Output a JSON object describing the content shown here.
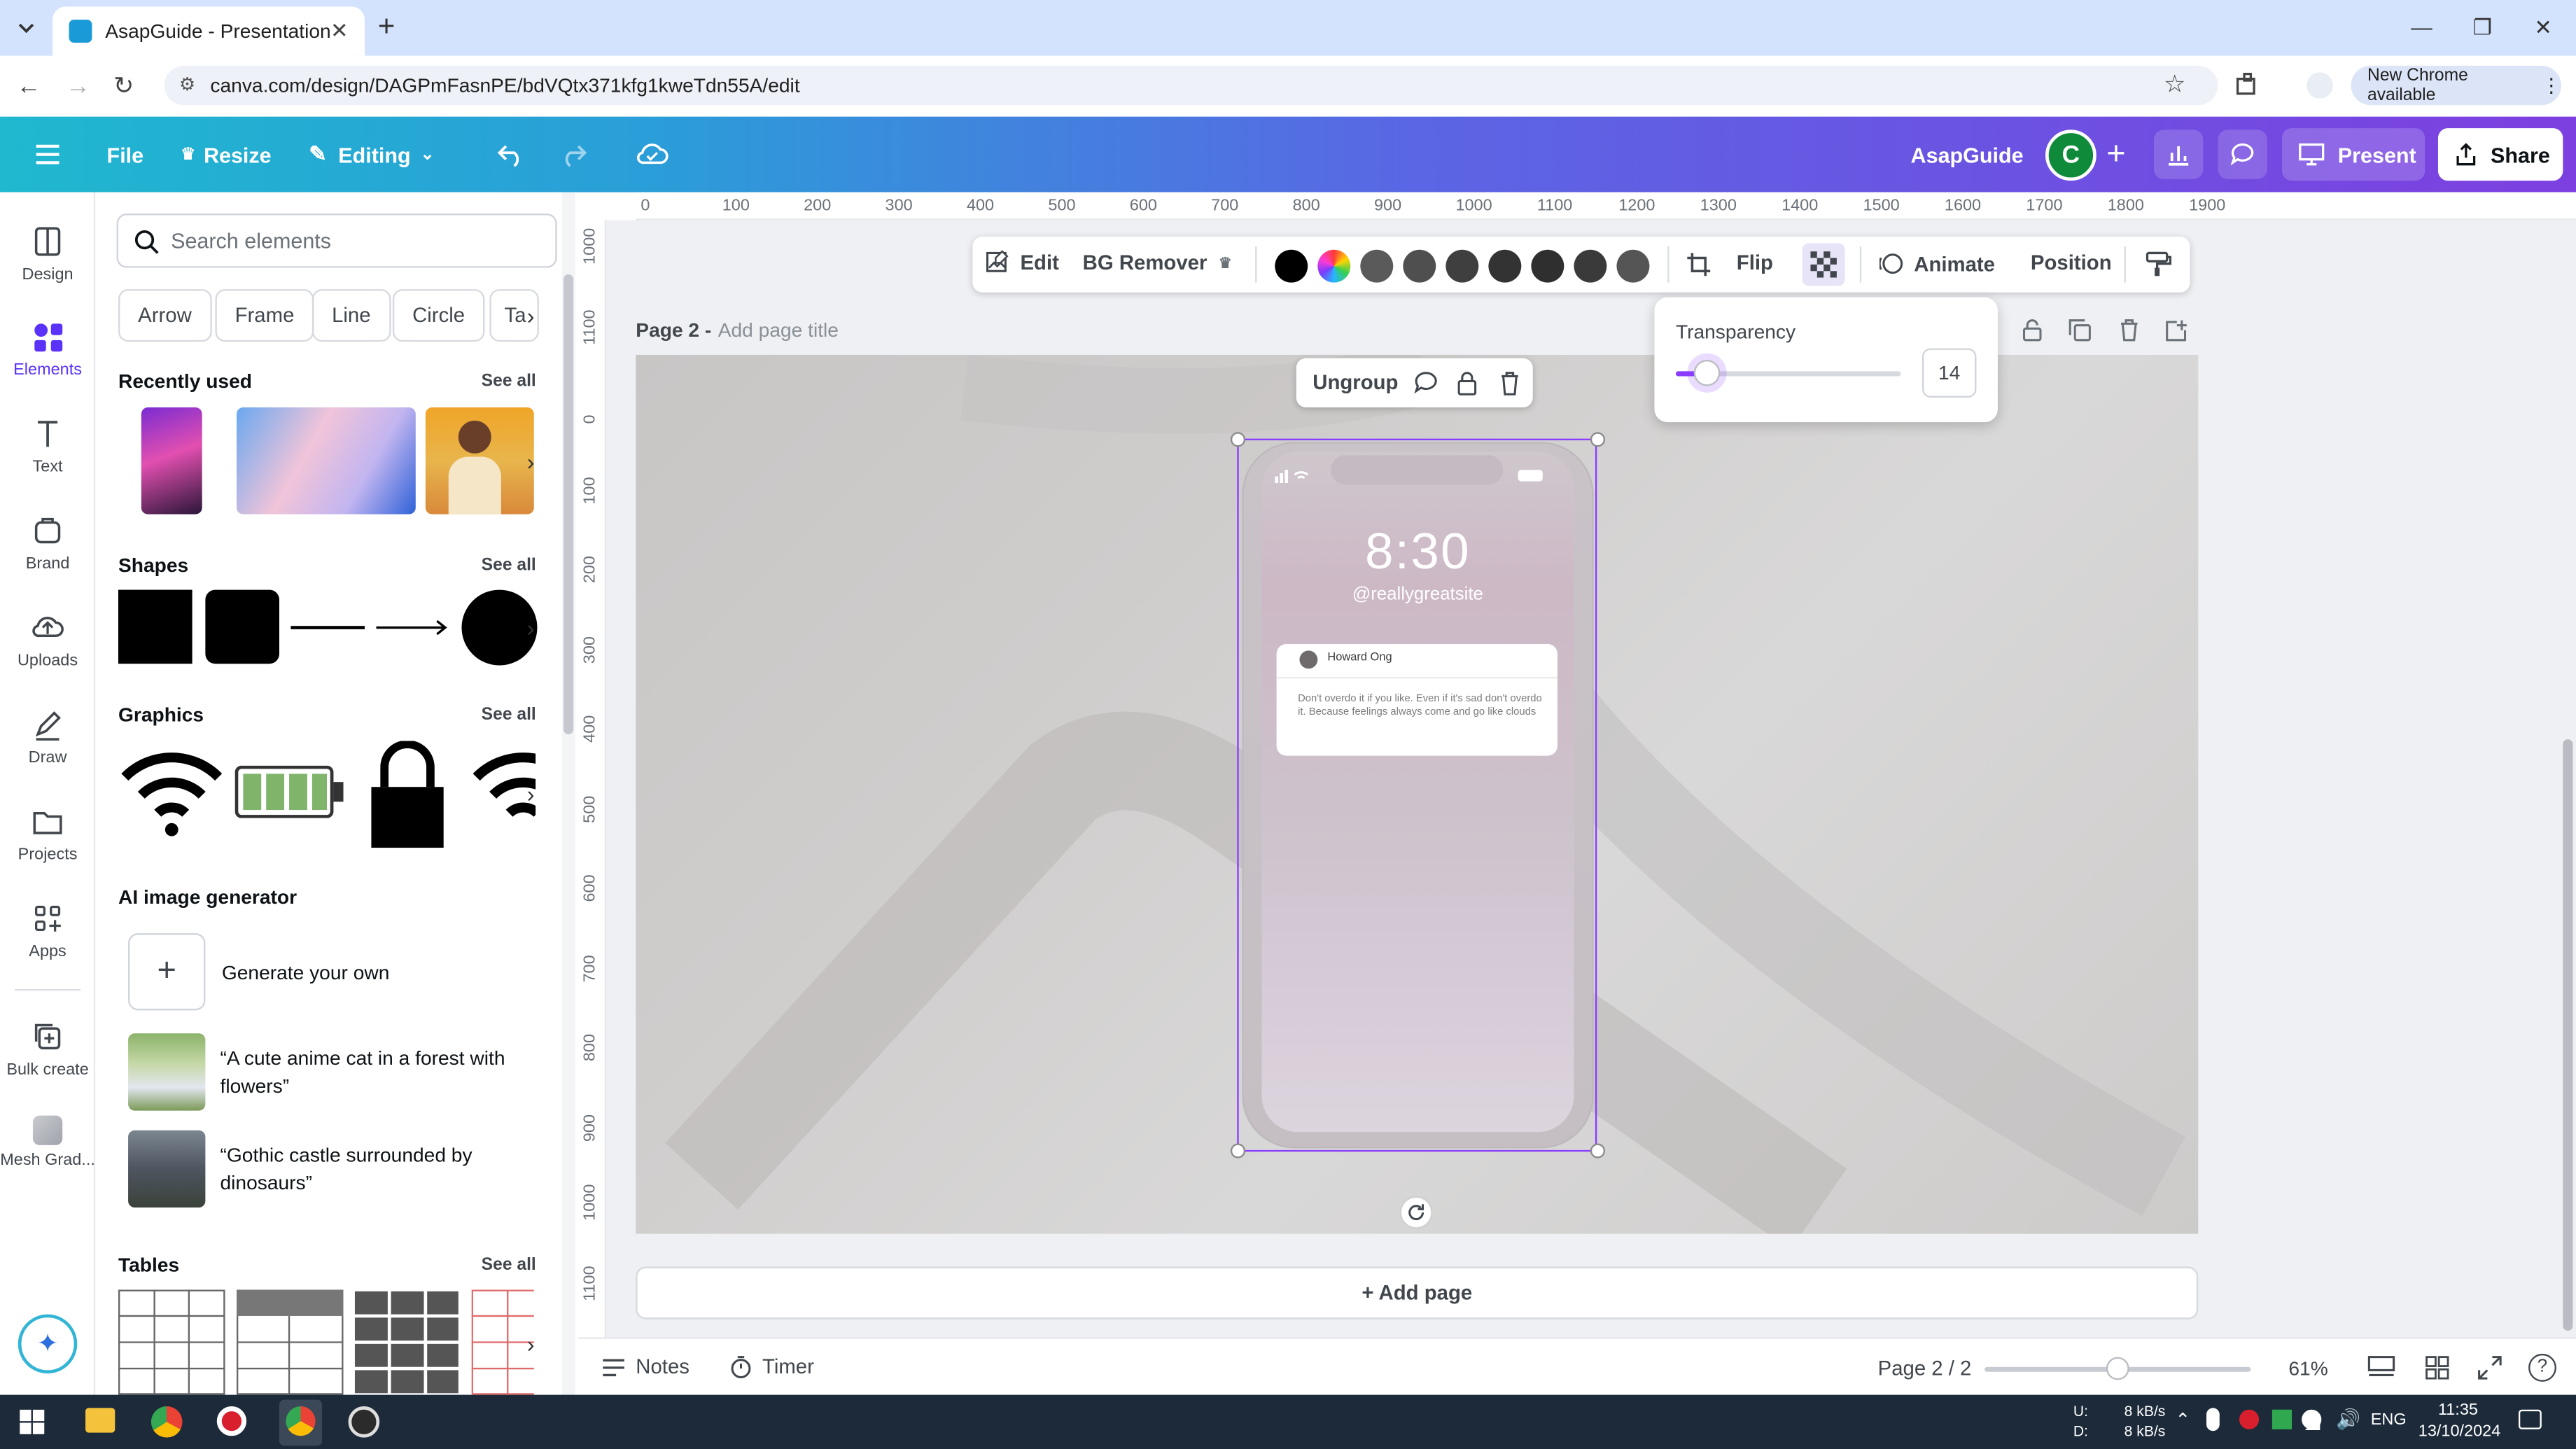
{
  "browser": {
    "tab_title": "AsapGuide - Presentation",
    "url": "canva.com/design/DAGPmFasnPE/bdVQtx371kfg1kweTdn55A/edit",
    "new_chrome": "New Chrome available"
  },
  "toolbar": {
    "file": "File",
    "resize": "Resize",
    "editing": "Editing",
    "team_name": "AsapGuide",
    "avatar_initial": "C",
    "present": "Present",
    "share": "Share"
  },
  "rail": {
    "items": [
      {
        "label": "Design",
        "icon": "design-icon"
      },
      {
        "label": "Elements",
        "icon": "elements-icon"
      },
      {
        "label": "Text",
        "icon": "text-icon"
      },
      {
        "label": "Brand",
        "icon": "brand-icon"
      },
      {
        "label": "Uploads",
        "icon": "uploads-icon"
      },
      {
        "label": "Draw",
        "icon": "draw-icon"
      },
      {
        "label": "Projects",
        "icon": "projects-icon"
      },
      {
        "label": "Apps",
        "icon": "apps-icon"
      },
      {
        "label": "Bulk create",
        "icon": "bulk-create-icon"
      },
      {
        "label": "Mesh Grad...",
        "icon": "mesh-gradient-icon"
      }
    ]
  },
  "panel": {
    "search_placeholder": "Search elements",
    "chips": [
      "Arrow",
      "Frame",
      "Line",
      "Circle",
      "Ta"
    ],
    "see_all": "See all",
    "recently_used": "Recently used",
    "shapes": "Shapes",
    "graphics": "Graphics",
    "ai_generator": "AI image generator",
    "generate_own": "Generate your own",
    "prompts": [
      "“A cute anime cat in a forest with flowers”",
      "“Gothic castle surrounded by dinosaurs”"
    ],
    "tables": "Tables"
  },
  "ruler": {
    "h_ticks": [
      "0",
      "100",
      "200",
      "300",
      "400",
      "500",
      "600",
      "700",
      "800",
      "900",
      "1000",
      "1100",
      "1200",
      "1300",
      "1400",
      "1500",
      "1600",
      "1700",
      "1800",
      "1900"
    ],
    "v_ticks": [
      "1000",
      "1100",
      "0",
      "100",
      "200",
      "300",
      "400",
      "500",
      "600",
      "700",
      "800",
      "900",
      "1000",
      "1100"
    ]
  },
  "context": {
    "edit": "Edit",
    "bg_remover": "BG Remover",
    "flip": "Flip",
    "animate": "Animate",
    "position": "Position",
    "swatches": [
      "#000000",
      "rainbow",
      "#5a5a5a",
      "#4f4f4f",
      "#3f3f3f",
      "#333333",
      "#2f2f2f",
      "#555555"
    ]
  },
  "transparency": {
    "label": "Transparency",
    "value": "14",
    "fraction": 0.14
  },
  "page": {
    "title_prefix": "Page 2 -",
    "title_placeholder": "Add page title",
    "ungroup": "Ungroup"
  },
  "phone": {
    "time": "8:30",
    "handle": "@reallygreatsite",
    "notif_name": "Howard Ong",
    "notif_text": "Don't overdo it if you like. Even if it's sad don't overdo it. Because feelings always come and go like clouds"
  },
  "add_page": "+ Add page",
  "bottom": {
    "notes": "Notes",
    "timer": "Timer",
    "page_count": "Page 2 / 2",
    "zoom": "61%",
    "zoom_fraction": 0.5
  },
  "taskbar": {
    "net_up": "U:",
    "net_down": "D:",
    "up_speed": "8 kB/s",
    "down_speed": "8 kB/s",
    "lang": "ENG",
    "time": "11:35",
    "date": "13/10/2024"
  },
  "colors": {
    "accent": "#8b3dff",
    "selection": "#8b3dff",
    "avatar": "#0f8a3a"
  }
}
